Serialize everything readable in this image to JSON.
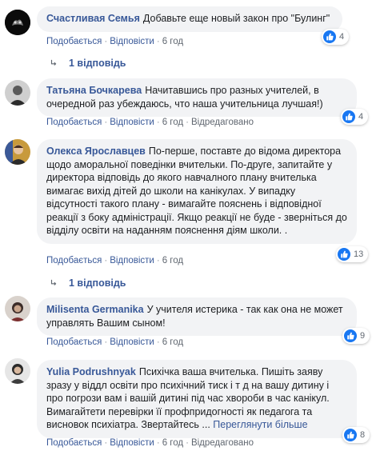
{
  "comments": [
    {
      "author": "Счастливая Семья",
      "text": "Добавьте еще новый закон про \"Булинг\"",
      "like_label": "Подобається",
      "reply_label": "Відповісти",
      "time": "6 год",
      "edited": "",
      "reactions": "4",
      "replies": "1 відповідь"
    },
    {
      "author": "Татьяна Бочкарева",
      "text": "Начитавшись про разных учителей, в очередной раз убеждаюсь, что наша учительница лучшая!)",
      "like_label": "Подобається",
      "reply_label": "Відповісти",
      "time": "6 год",
      "edited": "Відредаговано",
      "reactions": "4"
    },
    {
      "author": "Олекса Ярославцев",
      "text": "По-перше, поставте до відома директора щодо аморальної поведінки вчительки. По-друге, запитайте у директора відповідь до якого навчалного плану вчителька вимагає вихід дітей до школи на канікулах. У випадку відсутності такого плану - вимагайте пояснень і відповідної реакції з боку адміністрації. Якщо реакції не буде - зверніться до відділу освіти на наданням пояснення діям школи. .",
      "like_label": "Подобається",
      "reply_label": "Відповісти",
      "time": "6 год",
      "edited": "",
      "reactions": "13",
      "replies": "1 відповідь"
    },
    {
      "author": "Milisenta Germanika",
      "text": "У учителя истерика - так как она не может управлять Вашим сыном!",
      "like_label": "Подобається",
      "reply_label": "Відповісти",
      "time": "6 год",
      "edited": "",
      "reactions": "9"
    },
    {
      "author": "Yulia Podrushnyak",
      "text": "Психічка ваша вчителька. Пишіть заяву зразу у віддл освіти про психічний тиск і т д на вашу дитину і про погрози вам і вашій дитині під час хвороби в час канікул. Вимагайтети перевірки її профпридогності як педагога та висновок психіатра. Звертайтесь ...",
      "see_more": "Переглянути більше",
      "like_label": "Подобається",
      "reply_label": "Відповісти",
      "time": "6 год",
      "edited": "Відредаговано",
      "reactions": "8"
    }
  ]
}
